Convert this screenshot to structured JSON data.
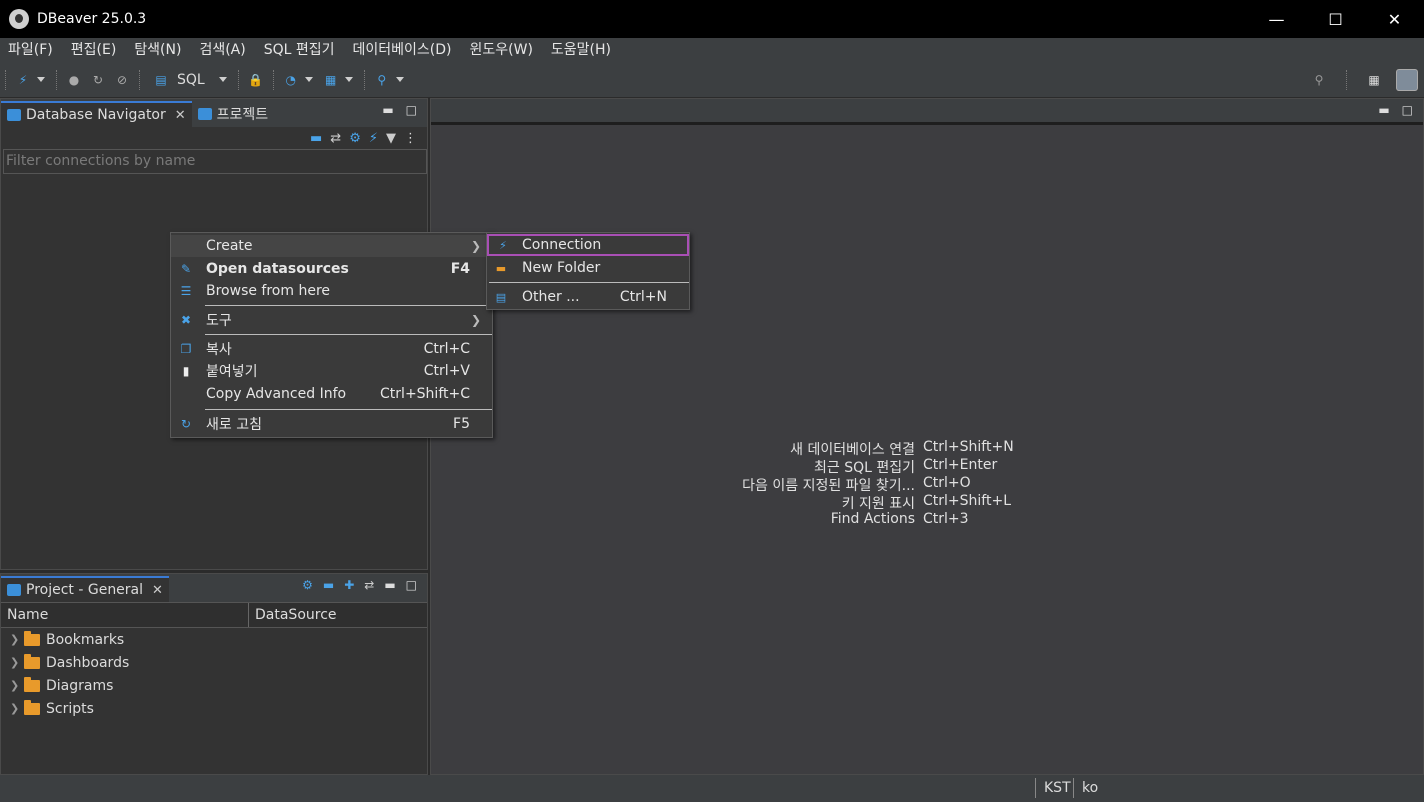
{
  "window": {
    "title": "DBeaver 25.0.3",
    "controls": [
      "minimize",
      "maximize",
      "close"
    ]
  },
  "menu": [
    "파일(F)",
    "편집(E)",
    "탐색(N)",
    "검색(A)",
    "SQL 편집기",
    "데이터베이스(D)",
    "윈도우(W)",
    "도움말(H)"
  ],
  "toolbar": {
    "sql_label": "SQL"
  },
  "navigator": {
    "tab_active": "Database Navigator",
    "tab_other": "프로젝트",
    "filter_placeholder": "Filter connections by name"
  },
  "project": {
    "tab": "Project - General",
    "columns": [
      "Name",
      "DataSource"
    ],
    "items": [
      "Bookmarks",
      "Dashboards",
      "Diagrams",
      "Scripts"
    ]
  },
  "context_menu": {
    "create": "Create",
    "open_datasources": "Open datasources",
    "open_datasources_key": "F4",
    "browse": "Browse from here",
    "tools": "도구",
    "copy": "복사",
    "copy_key": "Ctrl+C",
    "paste": "붙여넣기",
    "paste_key": "Ctrl+V",
    "copy_advanced": "Copy Advanced Info",
    "copy_advanced_key": "Ctrl+Shift+C",
    "refresh": "새로 고침",
    "refresh_key": "F5"
  },
  "submenu": {
    "connection": "Connection",
    "new_folder": "New Folder",
    "other": "Other ...",
    "other_key": "Ctrl+N"
  },
  "shortcuts": [
    {
      "label": "새 데이터베이스 연결",
      "key": "Ctrl+Shift+N"
    },
    {
      "label": "최근 SQL 편집기",
      "key": "Ctrl+Enter"
    },
    {
      "label": "다음 이름 지정된 파일 찾기...",
      "key": "Ctrl+O"
    },
    {
      "label": "키 지원 표시",
      "key": "Ctrl+Shift+L"
    },
    {
      "label": "Find Actions",
      "key": "Ctrl+3"
    }
  ],
  "status": {
    "timezone": "KST",
    "locale": "ko"
  },
  "colors": {
    "accent": "#3a7bd5",
    "highlight_border": "#a94fb5",
    "folder": "#e89a2b"
  }
}
